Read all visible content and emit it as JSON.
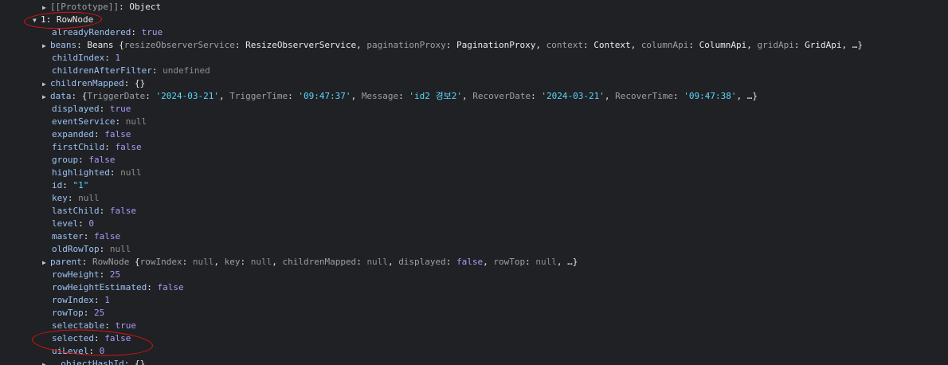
{
  "prototype": {
    "key": "[[Prototype]]",
    "value": "Object"
  },
  "node": {
    "index": "1",
    "class": "RowNode"
  },
  "colors": {
    "annotation": "#e3130f",
    "key": "#9cc3f5",
    "number": "#a89bf9",
    "string": "#5cd5fb",
    "null": "#8f8f8f",
    "background": "#202124"
  },
  "props": {
    "alreadyRendered": {
      "key": "alreadyRendered",
      "value": "true"
    },
    "beans": {
      "key": "beans",
      "class": "Beans",
      "pairs": [
        {
          "k": "resizeObserverService",
          "v": "ResizeObserverService"
        },
        {
          "k": "paginationProxy",
          "v": "PaginationProxy"
        },
        {
          "k": "context",
          "v": "Context"
        },
        {
          "k": "columnApi",
          "v": "ColumnApi"
        },
        {
          "k": "gridApi",
          "v": "GridApi"
        }
      ],
      "more": "…"
    },
    "childIndex": {
      "key": "childIndex",
      "value": "1"
    },
    "childrenAfterFilter": {
      "key": "childrenAfterFilter",
      "value": "undefined"
    },
    "childrenMapped": {
      "key": "childrenMapped",
      "value": "{}"
    },
    "data": {
      "key": "data",
      "pairs": [
        {
          "k": "TriggerDate",
          "v": "'2024-03-21'"
        },
        {
          "k": "TriggerTime",
          "v": "'09:47:37'"
        },
        {
          "k": "Message",
          "v": "'id2 경보2'"
        },
        {
          "k": "RecoverDate",
          "v": "'2024-03-21'"
        },
        {
          "k": "RecoverTime",
          "v": "'09:47:38'"
        }
      ],
      "more": "…"
    },
    "displayed": {
      "key": "displayed",
      "value": "true"
    },
    "eventService": {
      "key": "eventService",
      "value": "null"
    },
    "expanded": {
      "key": "expanded",
      "value": "false"
    },
    "firstChild": {
      "key": "firstChild",
      "value": "false"
    },
    "group": {
      "key": "group",
      "value": "false"
    },
    "highlighted": {
      "key": "highlighted",
      "value": "null"
    },
    "id": {
      "key": "id",
      "value": "\"1\""
    },
    "key": {
      "key": "key",
      "value": "null"
    },
    "lastChild": {
      "key": "lastChild",
      "value": "false"
    },
    "level": {
      "key": "level",
      "value": "0"
    },
    "master": {
      "key": "master",
      "value": "false"
    },
    "oldRowTop": {
      "key": "oldRowTop",
      "value": "null"
    },
    "parent": {
      "key": "parent",
      "class": "RowNode",
      "pairs": [
        {
          "k": "rowIndex",
          "v": "null"
        },
        {
          "k": "key",
          "v": "null"
        },
        {
          "k": "childrenMapped",
          "v": "null"
        },
        {
          "k": "displayed",
          "v": "false"
        },
        {
          "k": "rowTop",
          "v": "null"
        }
      ],
      "more": "…"
    },
    "rowHeight": {
      "key": "rowHeight",
      "value": "25"
    },
    "rowHeightEstimated": {
      "key": "rowHeightEstimated",
      "value": "false"
    },
    "rowIndex": {
      "key": "rowIndex",
      "value": "1"
    },
    "rowTop": {
      "key": "rowTop",
      "value": "25"
    },
    "selectable": {
      "key": "selectable",
      "value": "true"
    },
    "selected": {
      "key": "selected",
      "value": "false"
    },
    "uiLevel": {
      "key": "uiLevel",
      "value": "0"
    },
    "partial": {
      "key": "__objectHashId",
      "value": "{}"
    }
  }
}
